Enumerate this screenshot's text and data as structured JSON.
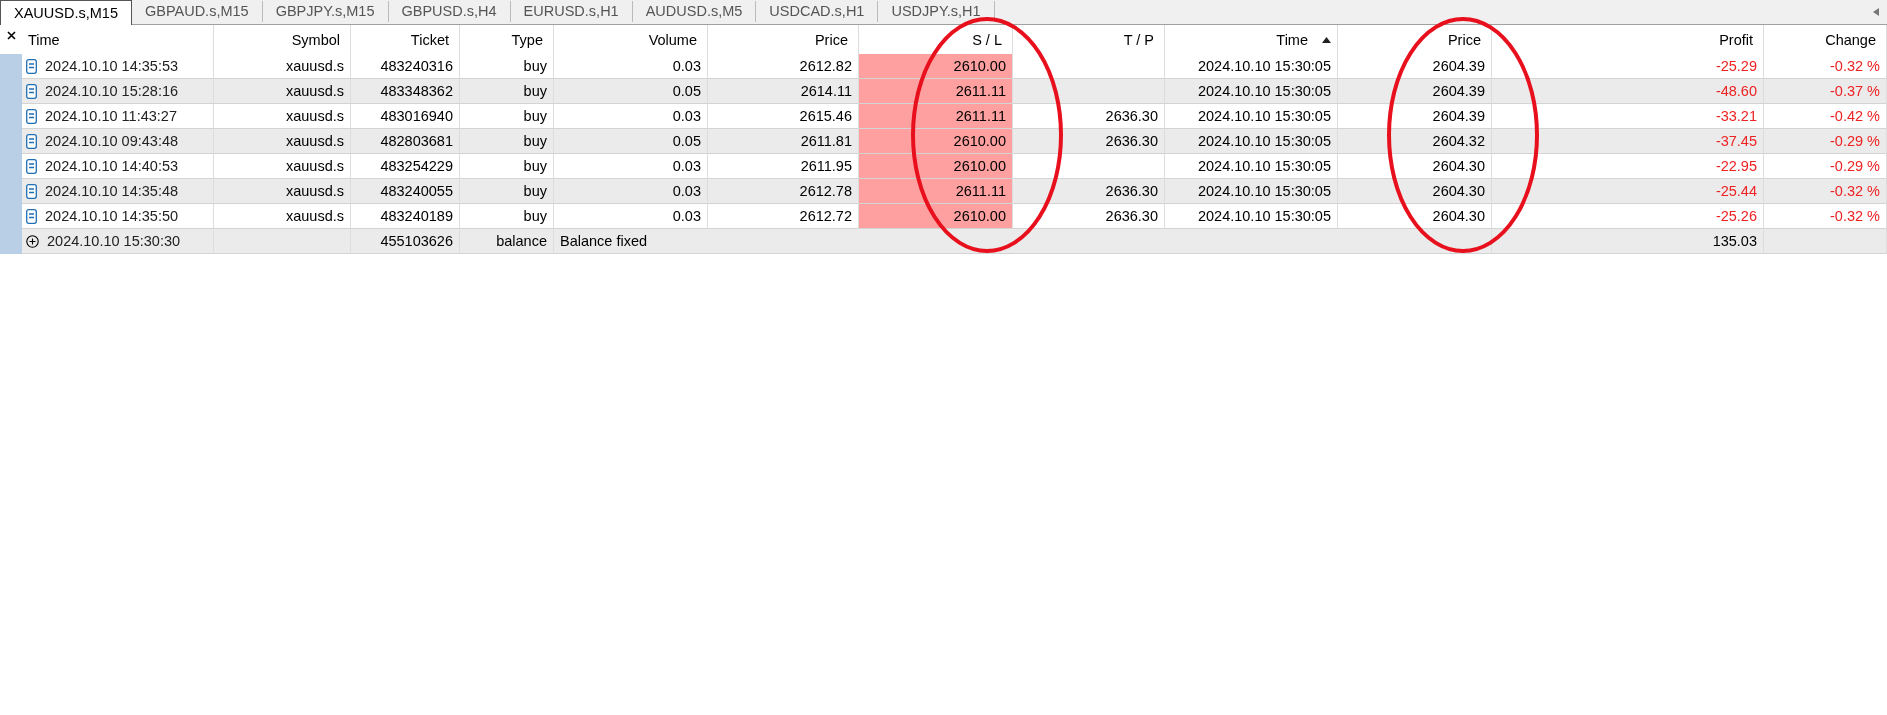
{
  "tabs": [
    {
      "label": "XAUUSD.s,M15",
      "selected": true
    },
    {
      "label": "GBPAUD.s,M15",
      "selected": false
    },
    {
      "label": "GBPJPY.s,M15",
      "selected": false
    },
    {
      "label": "GBPUSD.s,H4",
      "selected": false
    },
    {
      "label": "EURUSD.s,H1",
      "selected": false
    },
    {
      "label": "AUDUSD.s,M5",
      "selected": false
    },
    {
      "label": "USDCAD.s,H1",
      "selected": false
    },
    {
      "label": "USDJPY.s,H1",
      "selected": false
    }
  ],
  "table": {
    "columns": [
      {
        "label": "Time",
        "sorted": false
      },
      {
        "label": "Symbol",
        "sorted": false
      },
      {
        "label": "Ticket",
        "sorted": false
      },
      {
        "label": "Type",
        "sorted": false
      },
      {
        "label": "Volume",
        "sorted": false
      },
      {
        "label": "Price",
        "sorted": false
      },
      {
        "label": "S / L",
        "sorted": false
      },
      {
        "label": "T / P",
        "sorted": false
      },
      {
        "label": "Time",
        "sorted": true
      },
      {
        "label": "Price",
        "sorted": false
      },
      {
        "label": "Profit",
        "sorted": false
      },
      {
        "label": "Change",
        "sorted": false
      }
    ],
    "rows": [
      {
        "kind": "order",
        "time": "2024.10.10 14:35:53",
        "symbol": "xauusd.s",
        "ticket": "483240316",
        "type": "buy",
        "volume": "0.03",
        "price": "2612.82",
        "sl": "2610.00",
        "sl_highlight": true,
        "close_time": "2024.10.10 15:30:05",
        "current_price": "2604.39",
        "profit": "-25.29",
        "change": "-0.32 %",
        "negative": true
      },
      {
        "kind": "order",
        "time": "2024.10.10 15:28:16",
        "symbol": "xauusd.s",
        "ticket": "483348362",
        "type": "buy",
        "volume": "0.05",
        "price": "2614.11",
        "sl": "2611.11",
        "sl_highlight": true,
        "close_time": "2024.10.10 15:30:05",
        "current_price": "2604.39",
        "profit": "-48.60",
        "change": "-0.37 %",
        "negative": true
      },
      {
        "kind": "order",
        "time": "2024.10.10 11:43:27",
        "symbol": "xauusd.s",
        "ticket": "483016940",
        "type": "buy",
        "volume": "0.03",
        "price": "2615.46",
        "sl": "2611.11",
        "sl_highlight": true,
        "tp": "2636.30",
        "close_time": "2024.10.10 15:30:05",
        "current_price": "2604.39",
        "profit": "-33.21",
        "change": "-0.42 %",
        "negative": true
      },
      {
        "kind": "order",
        "time": "2024.10.10 09:43:48",
        "symbol": "xauusd.s",
        "ticket": "482803681",
        "type": "buy",
        "volume": "0.05",
        "price": "2611.81",
        "sl": "2610.00",
        "sl_highlight": true,
        "tp": "2636.30",
        "close_time": "2024.10.10 15:30:05",
        "current_price": "2604.32",
        "profit": "-37.45",
        "change": "-0.29 %",
        "negative": true
      },
      {
        "kind": "order",
        "time": "2024.10.10 14:40:53",
        "symbol": "xauusd.s",
        "ticket": "483254229",
        "type": "buy",
        "volume": "0.03",
        "price": "2611.95",
        "sl": "2610.00",
        "sl_highlight": true,
        "close_time": "2024.10.10 15:30:05",
        "current_price": "2604.30",
        "profit": "-22.95",
        "change": "-0.29 %",
        "negative": true
      },
      {
        "kind": "order",
        "time": "2024.10.10 14:35:48",
        "symbol": "xauusd.s",
        "ticket": "483240055",
        "type": "buy",
        "volume": "0.03",
        "price": "2612.78",
        "sl": "2611.11",
        "sl_highlight": true,
        "tp": "2636.30",
        "close_time": "2024.10.10 15:30:05",
        "current_price": "2604.30",
        "profit": "-25.44",
        "change": "-0.32 %",
        "negative": true
      },
      {
        "kind": "order",
        "time": "2024.10.10 14:35:50",
        "symbol": "xauusd.s",
        "ticket": "483240189",
        "type": "buy",
        "volume": "0.03",
        "price": "2612.72",
        "sl": "2610.00",
        "sl_highlight": true,
        "tp": "2636.30",
        "close_time": "2024.10.10 15:30:05",
        "current_price": "2604.30",
        "profit": "-25.26",
        "change": "-0.32 %",
        "negative": true
      },
      {
        "kind": "balance",
        "time": "2024.10.10 15:30:30",
        "ticket": "455103626",
        "type": "balance",
        "comment": "Balance fixed",
        "profit": "135.03",
        "negative": false
      }
    ]
  },
  "annotations": [
    {
      "kind": "ellipse",
      "color": "#e8101c"
    },
    {
      "kind": "ellipse",
      "color": "#e8101c"
    }
  ]
}
